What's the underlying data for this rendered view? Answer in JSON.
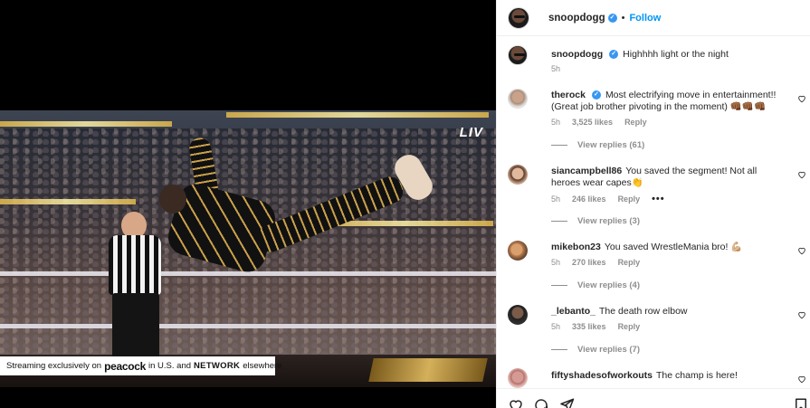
{
  "video": {
    "live_badge": "LIV",
    "ticker": {
      "prefix": "Streaming exclusively on",
      "brand": "peacock",
      "middle": "in U.S. and",
      "network": "NETWORK",
      "suffix": "elsewhere"
    }
  },
  "header": {
    "username": "snoopdogg",
    "dot": "•",
    "follow_label": "Follow",
    "verified_glyph": "✓"
  },
  "caption": {
    "username": "snoopdogg",
    "text": "Highhhh light or the night",
    "time": "5h"
  },
  "comments": [
    {
      "username": "therock",
      "verified": true,
      "text": "Most electrifying move in entertainment!! (Great job brother pivoting in the moment) 👊🏾👊🏾👊🏾",
      "time": "5h",
      "likes": "3,525 likes",
      "reply": "Reply",
      "view_replies": "View replies (61)"
    },
    {
      "username": "siancampbell86",
      "verified": false,
      "text": "You saved the segment! Not all heroes wear capes👏",
      "time": "5h",
      "likes": "246 likes",
      "reply": "Reply",
      "more": "•••",
      "view_replies": "View replies (3)"
    },
    {
      "username": "mikebon23",
      "verified": false,
      "text": "You saved WrestleMania bro! 💪🏼",
      "time": "5h",
      "likes": "270 likes",
      "reply": "Reply",
      "view_replies": "View replies (4)"
    },
    {
      "username": "_lebanto_",
      "verified": false,
      "text": "The death row elbow",
      "time": "5h",
      "likes": "335 likes",
      "reply": "Reply",
      "view_replies": "View replies (7)"
    },
    {
      "username": "fiftyshadesofworkouts",
      "verified": false,
      "text": "The champ is here!"
    }
  ],
  "icons": {
    "like": "heart-icon",
    "comment": "comment-icon",
    "share": "share-icon",
    "save": "bookmark-icon"
  },
  "colors": {
    "accent": "#0095f6",
    "verified": "#3897f0",
    "muted": "#8e8e8e"
  }
}
